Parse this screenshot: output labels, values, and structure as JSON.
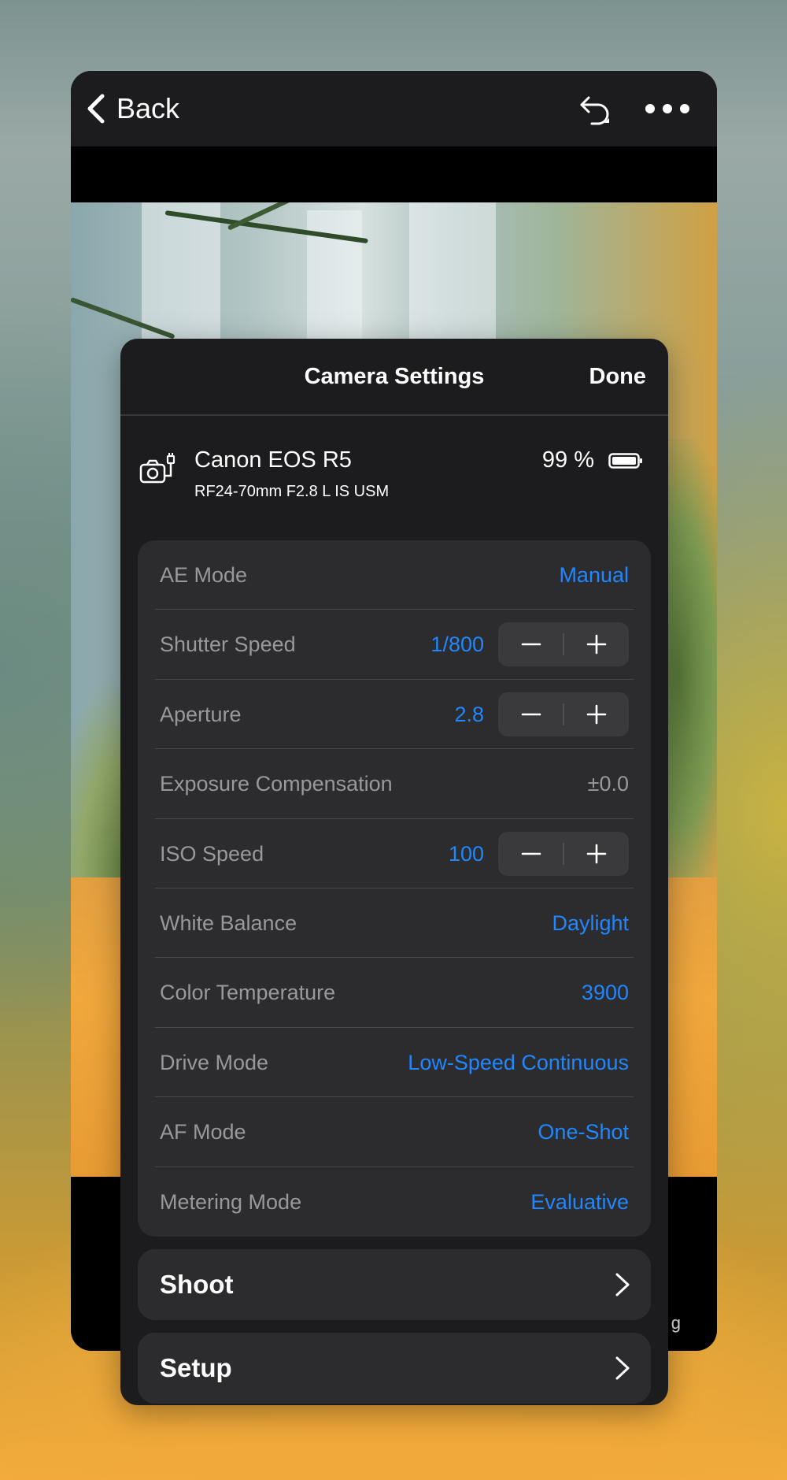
{
  "nav": {
    "back_label": "Back"
  },
  "background": {
    "caption": "g"
  },
  "sheet": {
    "title": "Camera Settings",
    "done_label": "Done"
  },
  "device": {
    "name": "Canon EOS R5",
    "lens": "RF24-70mm F2.8 L IS USM",
    "battery": "99 %"
  },
  "settings": [
    {
      "label": "AE Mode",
      "value": "Manual"
    },
    {
      "label": "Shutter Speed",
      "value": "1/800"
    },
    {
      "label": "Aperture",
      "value": "2.8"
    },
    {
      "label": "Exposure Compensation",
      "value": "±0.0"
    },
    {
      "label": "ISO Speed",
      "value": "100"
    },
    {
      "label": "White Balance",
      "value": "Daylight"
    },
    {
      "label": "Color Temperature",
      "value": "3900"
    },
    {
      "label": "Drive Mode",
      "value": "Low-Speed Continuous"
    },
    {
      "label": "AF Mode",
      "value": "One-Shot"
    },
    {
      "label": "Metering Mode",
      "value": "Evaluative"
    }
  ],
  "menu": {
    "shoot": "Shoot",
    "setup": "Setup"
  },
  "colors": {
    "accent": "#1f87ff",
    "sheet_bg": "#1c1c1e",
    "group_bg": "#2c2c2e"
  },
  "icons": [
    "chevron-left-icon",
    "undo-icon",
    "more-icon",
    "camera-connected-icon",
    "battery-icon",
    "minus-icon",
    "plus-icon",
    "chevron-right-icon"
  ]
}
